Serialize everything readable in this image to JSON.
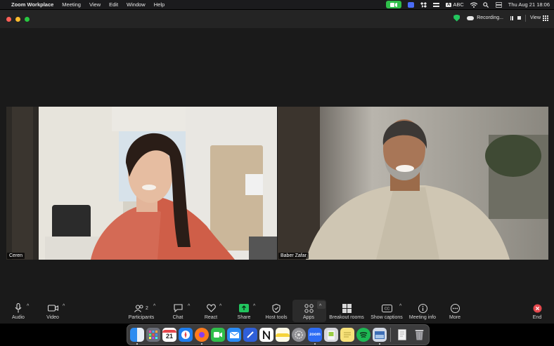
{
  "menubar": {
    "app_name": "Zoom Workplace",
    "menus": [
      "Meeting",
      "View",
      "Edit",
      "Window",
      "Help"
    ],
    "input_source": "ABC",
    "clock": "Thu Aug 21  18:06"
  },
  "titlebar": {
    "recording_label": "Recording...",
    "view_label": "View"
  },
  "participants": [
    {
      "name": "Ceren"
    },
    {
      "name": "Baber Zafar"
    }
  ],
  "toolbar": {
    "audio": "Audio",
    "video": "Video",
    "participants": "Participants",
    "participants_count": "2",
    "chat": "Chat",
    "react": "React",
    "share": "Share",
    "host_tools": "Host tools",
    "apps": "Apps",
    "breakout_rooms": "Breakout rooms",
    "show_captions": "Show captions",
    "meeting_info": "Meeting info",
    "more": "More",
    "end": "End"
  },
  "dock": {
    "calendar_day": "21",
    "zoom_label": "zoom",
    "items": [
      "finder-icon",
      "launchpad-icon",
      "calendar-icon",
      "safari-icon",
      "firefox-icon",
      "facetime-icon",
      "mail-icon",
      "xcode-icon",
      "notion-icon",
      "notes-icon",
      "system-settings-icon",
      "zoom-icon",
      "preview-icon",
      "stickies-icon",
      "spotify-icon",
      "screenshot-icon",
      "document-icon",
      "trash-icon"
    ]
  },
  "colors": {
    "recording_shield": "#23c55e",
    "share_accent": "#22c55e",
    "end_red": "#e5484d",
    "menubar_zoom": "#2fbf4a"
  }
}
